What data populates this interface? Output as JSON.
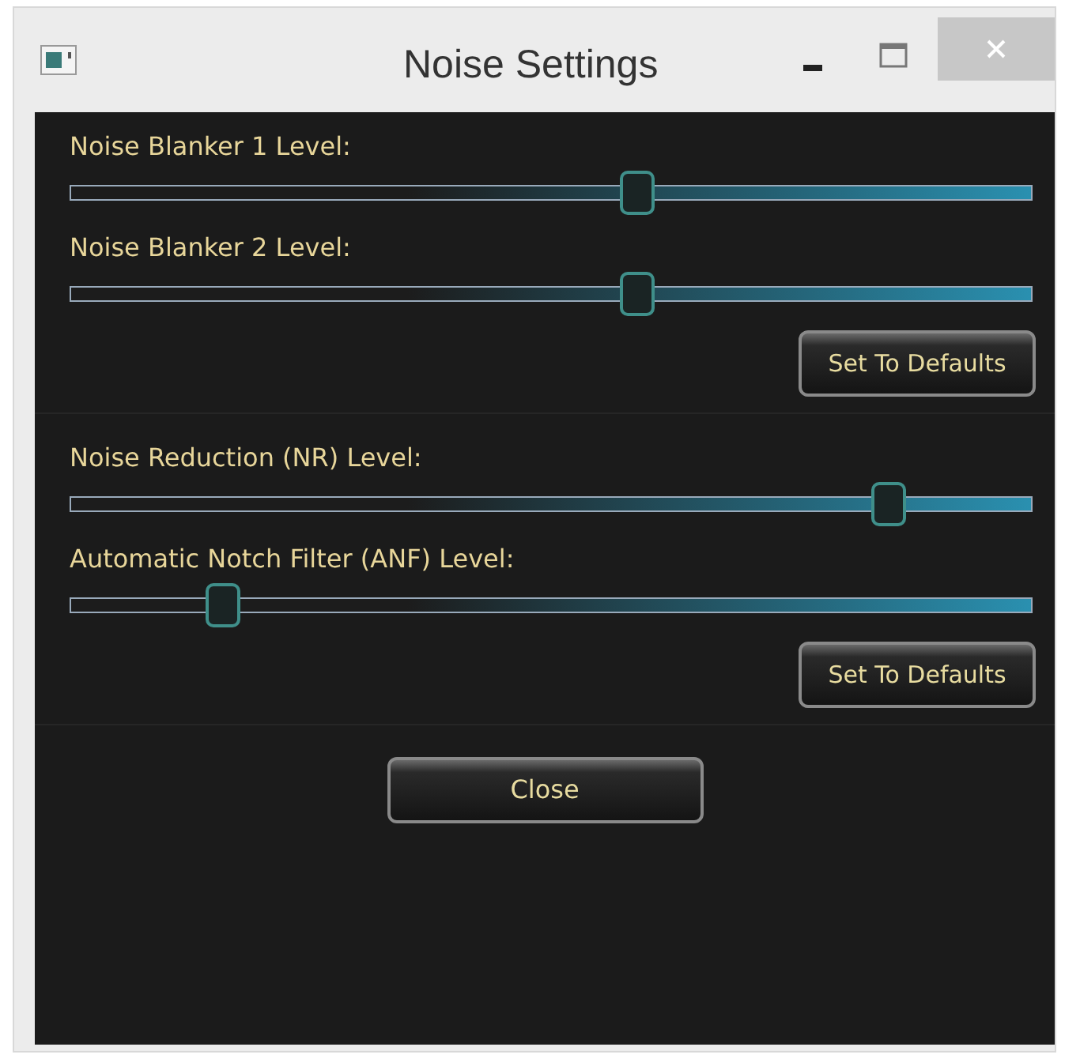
{
  "window": {
    "title": "Noise Settings"
  },
  "groups": [
    {
      "sliders": [
        {
          "label": "Noise Blanker 1 Level:",
          "level": 0.59
        },
        {
          "label": "Noise Blanker 2 Level:",
          "level": 0.59
        }
      ],
      "button": "Set To Defaults"
    },
    {
      "sliders": [
        {
          "label": "Noise Reduction (NR) Level:",
          "level": 0.85
        },
        {
          "label": "Automatic Notch Filter (ANF) Level:",
          "level": 0.16
        }
      ],
      "button": "Set To Defaults"
    }
  ],
  "close_button": "Close"
}
